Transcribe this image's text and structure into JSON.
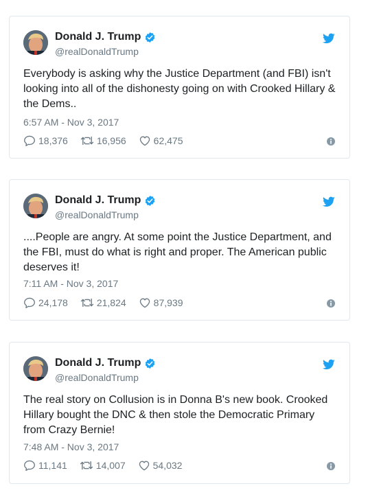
{
  "colors": {
    "verified": "#1da1f2",
    "bird": "#1da1f2",
    "muted": "#697882",
    "border": "#e1e8ed"
  },
  "icons": [
    "verified-badge-icon",
    "twitter-bird-icon",
    "reply-icon",
    "retweet-icon",
    "like-icon",
    "info-icon"
  ],
  "tweets": [
    {
      "author_name": "Donald J. Trump",
      "handle": "@realDonaldTrump",
      "text": "Everybody is asking why the Justice Department (and FBI) isn't looking into all of the dishonesty going on with Crooked Hillary & the Dems..",
      "timestamp": "6:57 AM - Nov 3, 2017",
      "replies": "18,376",
      "retweets": "16,956",
      "likes": "62,475"
    },
    {
      "author_name": "Donald J. Trump",
      "handle": "@realDonaldTrump",
      "text": "....People are angry. At some point the Justice Department, and the FBI, must do what is right and proper. The American public deserves it!",
      "timestamp": "7:11 AM - Nov 3, 2017",
      "replies": "24,178",
      "retweets": "21,824",
      "likes": "87,939"
    },
    {
      "author_name": "Donald J. Trump",
      "handle": "@realDonaldTrump",
      "text": "The real story on Collusion is in Donna B's new book. Crooked Hillary bought the DNC & then stole the Democratic Primary from Crazy Bernie!",
      "timestamp": "7:48 AM - Nov 3, 2017",
      "replies": "11,141",
      "retweets": "14,007",
      "likes": "54,032"
    }
  ]
}
